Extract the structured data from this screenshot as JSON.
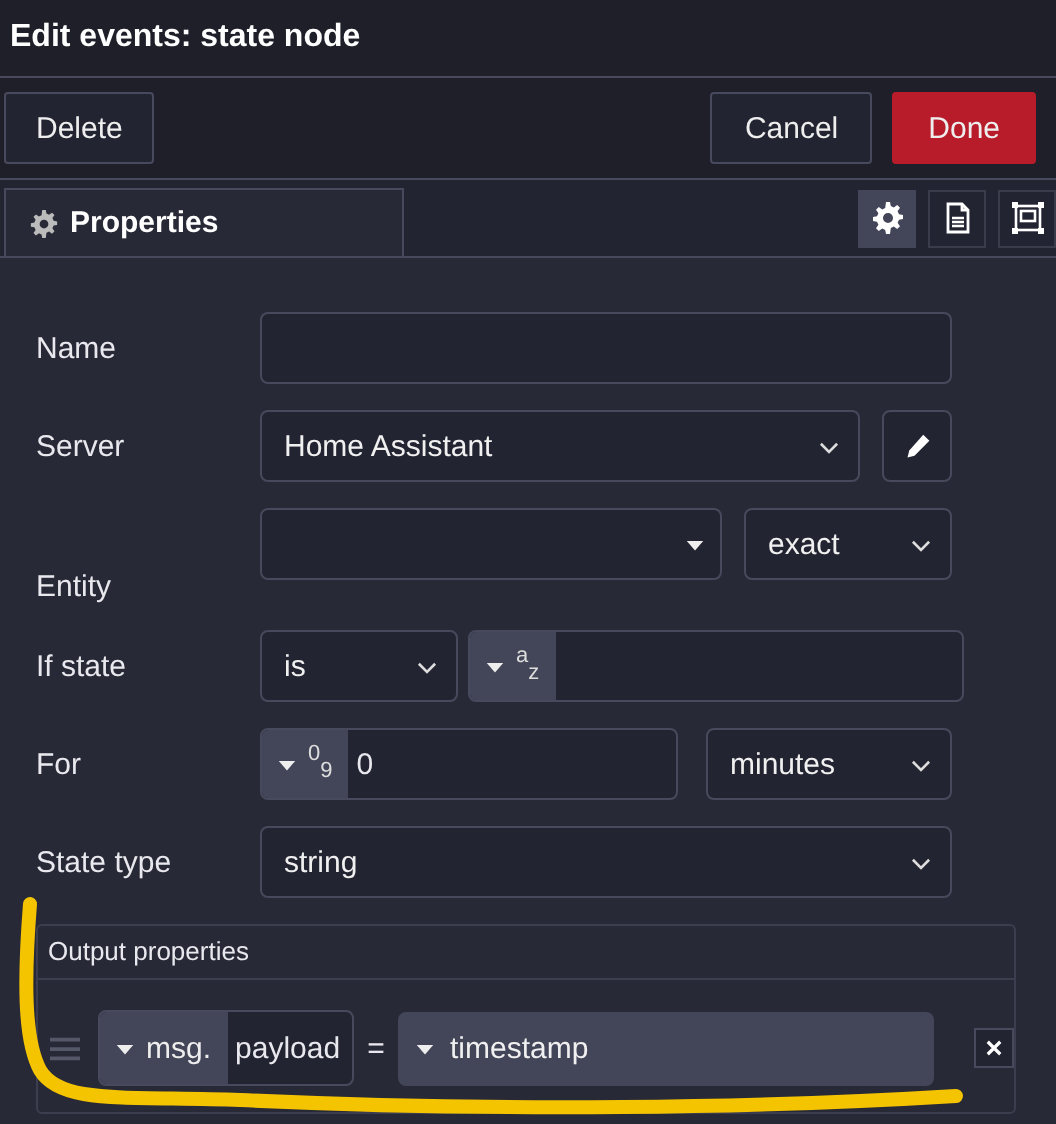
{
  "dialog": {
    "title": "Edit events: state node"
  },
  "buttons": [
    {
      "label": "Delete",
      "kind": "plain"
    },
    {
      "label": "Cancel",
      "kind": "plain"
    },
    {
      "label": "Done",
      "kind": "primary"
    }
  ],
  "tabs": [
    {
      "label": "Properties",
      "selected": true
    }
  ],
  "side_tabs": [
    {
      "kind": "settings",
      "selected": true
    },
    {
      "kind": "description",
      "selected": false
    },
    {
      "kind": "appearance",
      "selected": false
    }
  ],
  "form": [
    {
      "label": "Name",
      "kind": "text"
    },
    {
      "label": "Server",
      "kind": "select_edit",
      "value": "Home Assistant"
    },
    {
      "label": "Entity",
      "kind": "entity",
      "match": "exact"
    },
    {
      "label": "If state",
      "kind": "condition",
      "operator": "is",
      "type_label": "$^{a}$$_{z}$"
    },
    {
      "label": "For",
      "kind": "duration",
      "type_label": "$^{0}$$_{9}$",
      "value": "0",
      "unit": "minutes"
    },
    {
      "label": "State type",
      "kind": "select",
      "value": "string"
    }
  ],
  "output": {
    "title": "Output properties",
    "rows": [
      {
        "prefix": "msg.",
        "property": "payload",
        "operator": "=",
        "value": "timestamp"
      }
    ]
  },
  "annotation": {
    "kind": "underline_stroke"
  }
}
